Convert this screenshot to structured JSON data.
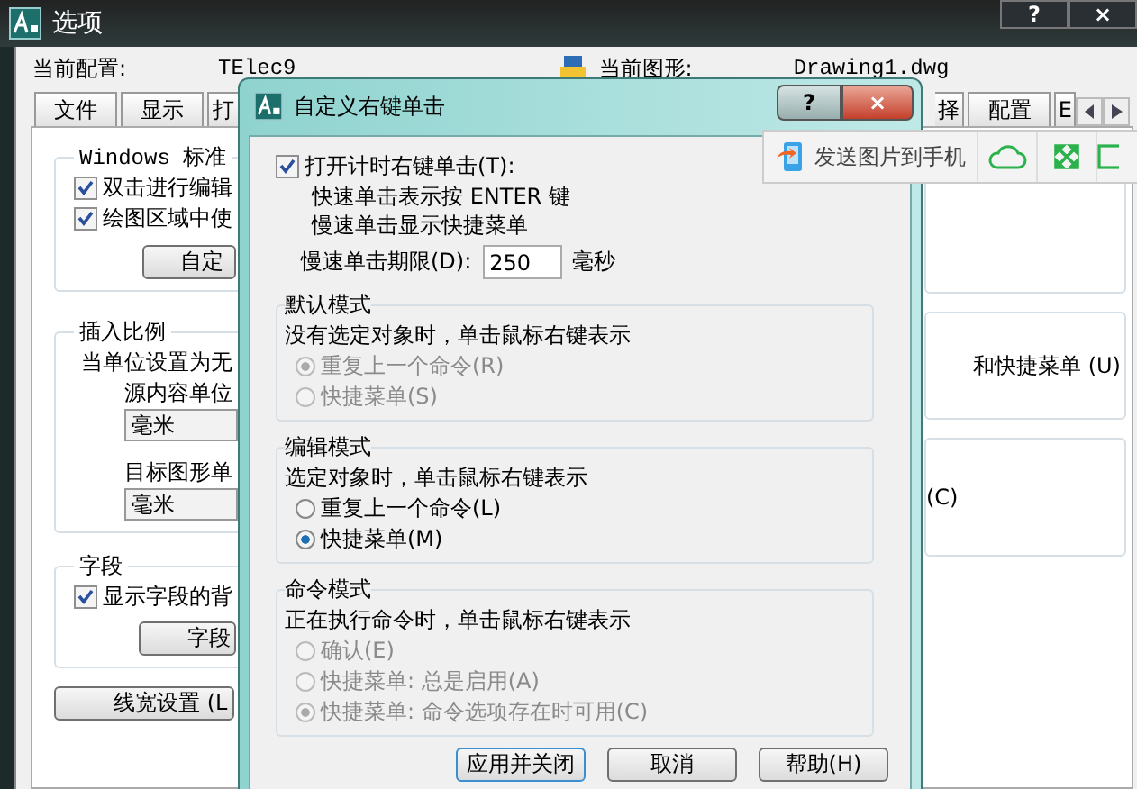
{
  "main_window": {
    "title": "选项",
    "help_button": "?",
    "close_button": "×"
  },
  "profile": {
    "label": "当前配置:",
    "value": "TElec9"
  },
  "drawing": {
    "label": "当前图形:",
    "value": "Drawing1.dwg"
  },
  "tabs_left": [
    {
      "label": "文件",
      "selected": false
    },
    {
      "label": "显示",
      "selected": false
    },
    {
      "label": "打",
      "selected": false
    }
  ],
  "tabs_right": [
    {
      "label": "择",
      "selected": false
    },
    {
      "label": "配置",
      "selected": false
    },
    {
      "label": "E",
      "selected": false
    }
  ],
  "windows_group": {
    "title": "Windows 标准",
    "options": [
      {
        "label": "双击进行编辑",
        "checked": true
      },
      {
        "label": "绘图区域中使",
        "checked": true
      }
    ],
    "button": "自定"
  },
  "insert_group": {
    "title": "插入比例",
    "hint": "当单位设置为无",
    "source_label": "源内容单位",
    "source_value": "毫米",
    "target_label": "目标图形单",
    "target_value": "毫米"
  },
  "field_group": {
    "title": "字段",
    "option": {
      "label": "显示字段的背",
      "checked": true
    },
    "button": "字段"
  },
  "lineweight_button": "线宽设置 (L",
  "right_texts": [
    "和快捷菜单 (U)",
    "(C)"
  ],
  "phone_toolbar": {
    "label": "发送图片到手机"
  },
  "dialog": {
    "title": "自定义右键单击",
    "help_button": "?",
    "close_button": "×",
    "timed": {
      "label": "打开计时右键单击(T):",
      "checked": true
    },
    "timed_lines": [
      "快速单击表示按 ENTER 键",
      "慢速单击显示快捷菜单"
    ],
    "duration_label": "慢速单击期限(D):",
    "duration_value": "250",
    "duration_unit": "毫秒",
    "groups": [
      {
        "title": "默认模式",
        "description": "没有选定对象时，单击鼠标右键表示",
        "disabled": true,
        "options": [
          {
            "label": "重复上一个命令(R)",
            "selected": true
          },
          {
            "label": "快捷菜单(S)",
            "selected": false
          }
        ]
      },
      {
        "title": "编辑模式",
        "description": "选定对象时，单击鼠标右键表示",
        "disabled": false,
        "options": [
          {
            "label": "重复上一个命令(L)",
            "selected": false
          },
          {
            "label": "快捷菜单(M)",
            "selected": true
          }
        ]
      },
      {
        "title": "命令模式",
        "description": "正在执行命令时，单击鼠标右键表示",
        "disabled": true,
        "options": [
          {
            "label": "确认(E)",
            "selected": false
          },
          {
            "label": "快捷菜单: 总是启用(A)",
            "selected": false
          },
          {
            "label": "快捷菜单: 命令选项存在时可用(C)",
            "selected": true
          }
        ]
      }
    ],
    "buttons": [
      "应用并关闭",
      "取消",
      "帮助(H)"
    ]
  }
}
